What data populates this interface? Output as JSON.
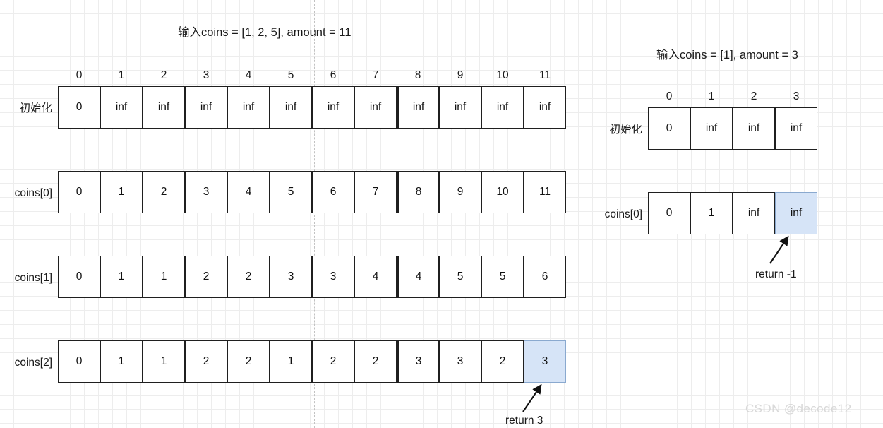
{
  "left": {
    "title": "输入coins = [1, 2, 5], amount = 11",
    "col_headers": [
      "0",
      "1",
      "2",
      "3",
      "4",
      "5",
      "6",
      "7",
      "8",
      "9",
      "10",
      "11"
    ],
    "rows": [
      {
        "label": "初始化",
        "values": [
          "0",
          "inf",
          "inf",
          "inf",
          "inf",
          "inf",
          "inf",
          "inf",
          "inf",
          "inf",
          "inf",
          "inf"
        ],
        "highlight_index": -1
      },
      {
        "label": "coins[0]",
        "values": [
          "0",
          "1",
          "2",
          "3",
          "4",
          "5",
          "6",
          "7",
          "8",
          "9",
          "10",
          "11"
        ],
        "highlight_index": -1
      },
      {
        "label": "coins[1]",
        "values": [
          "0",
          "1",
          "1",
          "2",
          "2",
          "3",
          "3",
          "4",
          "4",
          "5",
          "5",
          "6"
        ],
        "highlight_index": -1
      },
      {
        "label": "coins[2]",
        "values": [
          "0",
          "1",
          "1",
          "2",
          "2",
          "1",
          "2",
          "2",
          "3",
          "3",
          "2",
          "3"
        ],
        "highlight_index": 11
      }
    ],
    "annotation": "return 3"
  },
  "right": {
    "title": "输入coins = [1], amount =  3",
    "col_headers": [
      "0",
      "1",
      "2",
      "3"
    ],
    "rows": [
      {
        "label": "初始化",
        "values": [
          "0",
          "inf",
          "inf",
          "inf"
        ],
        "highlight_index": -1
      },
      {
        "label": "coins[0]",
        "values": [
          "0",
          "1",
          "inf",
          "inf"
        ],
        "highlight_index": 3
      }
    ],
    "annotation": "return -1"
  },
  "watermark": "CSDN @decode12",
  "colors": {
    "highlight_fill": "#d6e4f7",
    "highlight_border": "#8aa9cf",
    "cell_border": "#1f1f1f",
    "grid_minor": "#ededed",
    "grid_major": "#dcdcdc"
  }
}
